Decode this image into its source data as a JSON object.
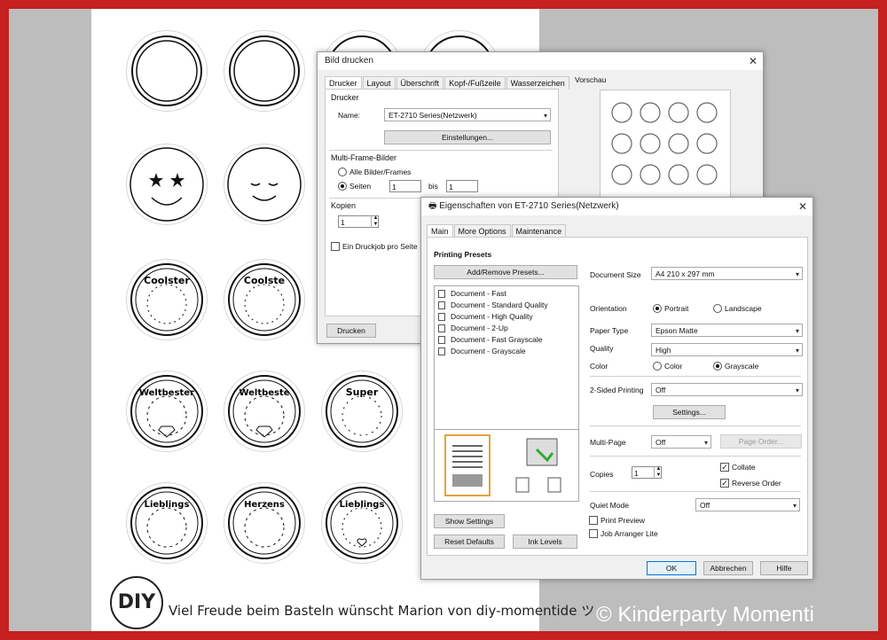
{
  "copyright": "© Kinderparty Momenti",
  "footer": {
    "logo_text": "DIY",
    "text": "Viel Freude beim Basteln wünscht Marion von diy-momentide ツ"
  },
  "stickers": {
    "labels": [
      "Coolster",
      "Coolste",
      "Weltbester",
      "Weltbeste",
      "Super",
      "Lieblings",
      "Herzens",
      "Lieblings"
    ]
  },
  "print_dialog": {
    "title": "Bild drucken",
    "tabs": [
      "Drucker",
      "Layout",
      "Überschrift",
      "Kopf-/Fußzeile",
      "Wasserzeichen"
    ],
    "drucker_group": "Drucker",
    "name_label": "Name:",
    "printer_name": "ET-2710 Series(Netzwerk)",
    "settings_button": "Einstellungen...",
    "multiframe_group": "Multi-Frame-Bilder",
    "all_frames": "Alle Bilder/Frames",
    "pages": "Seiten",
    "from": "1",
    "bis": "bis",
    "to": "1",
    "copies_group": "Kopien",
    "copies": "1",
    "one_job_per_page": "Ein Druckjob pro Seite",
    "print_button": "Drucken",
    "preview_label": "Vorschau"
  },
  "props_dialog": {
    "title": "Eigenschaften von ET-2710 Series(Netzwerk)",
    "tabs": [
      "Main",
      "More Options",
      "Maintenance"
    ],
    "presets_title": "Printing Presets",
    "add_remove": "Add/Remove Presets...",
    "presets": [
      "Document - Fast",
      "Document - Standard Quality",
      "Document - High Quality",
      "Document - 2-Up",
      "Document - Fast Grayscale",
      "Document - Grayscale"
    ],
    "show_settings": "Show Settings",
    "reset_defaults": "Reset Defaults",
    "ink_levels": "Ink Levels",
    "document_size_label": "Document Size",
    "document_size": "A4 210 x 297 mm",
    "orientation_label": "Orientation",
    "portrait": "Portrait",
    "landscape": "Landscape",
    "paper_type_label": "Paper Type",
    "paper_type": "Epson Matte",
    "quality_label": "Quality",
    "quality": "High",
    "color_label": "Color",
    "color": "Color",
    "grayscale": "Grayscale",
    "two_sided_label": "2-Sided Printing",
    "two_sided": "Off",
    "settings_button": "Settings...",
    "multipage_label": "Multi-Page",
    "multipage": "Off",
    "page_order": "Page Order...",
    "copies_label": "Copies",
    "copies": "1",
    "collate": "Collate",
    "reverse_order": "Reverse Order",
    "quiet_mode_label": "Quiet Mode",
    "quiet_mode": "Off",
    "print_preview": "Print Preview",
    "job_arranger": "Job Arranger Lite",
    "ok": "OK",
    "cancel": "Abbrechen",
    "help": "Hilfe"
  }
}
